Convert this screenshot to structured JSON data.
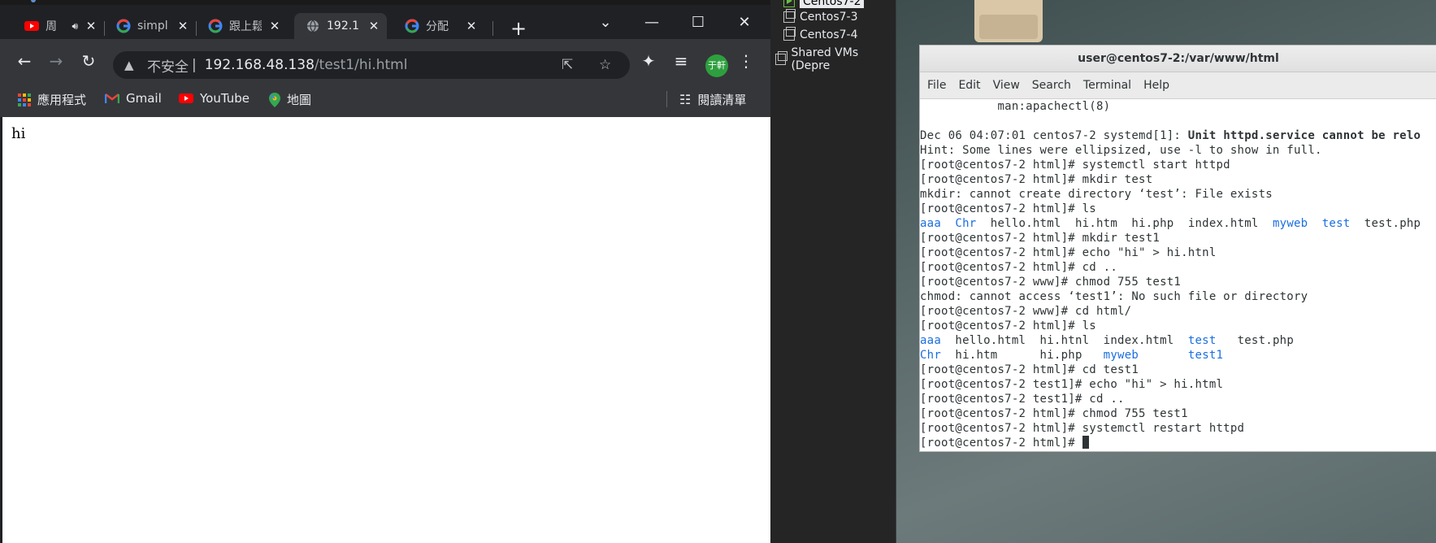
{
  "browser": {
    "tabs": [
      {
        "title": "周",
        "favicon": "youtube-icon",
        "audio": true
      },
      {
        "title": "simpl",
        "favicon": "google-icon"
      },
      {
        "title": "跟上鬆",
        "favicon": "google-icon"
      },
      {
        "title": "192.1",
        "favicon": "globe-icon",
        "active": true
      },
      {
        "title": "分配",
        "favicon": "google-icon"
      }
    ],
    "new_tab": "+",
    "window_controls": {
      "tab_search": "⌄",
      "minimize": "—",
      "maximize": "☐",
      "close": "✕"
    },
    "address": {
      "security_label": "不安全",
      "separator": "|",
      "host": "192.168.48.138",
      "path": "/test1/hi.html"
    },
    "profile_initials": "于軒",
    "bookmarks": [
      {
        "label": "應用程式",
        "icon": "apps-grid-icon"
      },
      {
        "label": "Gmail",
        "icon": "gmail-icon"
      },
      {
        "label": "YouTube",
        "icon": "youtube-icon"
      },
      {
        "label": "地圖",
        "icon": "maps-pin-icon"
      }
    ],
    "reading_list": "閱讀清單",
    "page_content": "hi"
  },
  "vm_library": {
    "items": [
      {
        "name": "Centos7-2",
        "selected": true,
        "running": true
      },
      {
        "name": "Centos7-3"
      },
      {
        "name": "Centos7-4"
      },
      {
        "name": "Shared VMs (Depre"
      }
    ]
  },
  "terminal": {
    "title": "user@centos7-2:/var/www/html",
    "menu": [
      "File",
      "Edit",
      "View",
      "Search",
      "Terminal",
      "Help"
    ],
    "lines": [
      [
        {
          "t": "           man:apachectl(8)"
        }
      ],
      [
        {
          "t": ""
        }
      ],
      [
        {
          "t": "Dec 06 04:07:01 centos7-2 systemd[1]: "
        },
        {
          "t": "Unit httpd.service cannot be relo",
          "c": "bold"
        }
      ],
      [
        {
          "t": "Hint: Some lines were ellipsized, use -l to show in full."
        }
      ],
      [
        {
          "t": "[root@centos7-2 html]# systemctl start httpd"
        }
      ],
      [
        {
          "t": "[root@centos7-2 html]# mkdir test"
        }
      ],
      [
        {
          "t": "mkdir: cannot create directory ‘test’: File exists"
        }
      ],
      [
        {
          "t": "[root@centos7-2 html]# ls"
        }
      ],
      [
        {
          "t": "aaa",
          "c": "blue"
        },
        {
          "t": "  "
        },
        {
          "t": "Chr",
          "c": "blue"
        },
        {
          "t": "  hello.html  hi.htm  hi.php  index.html  "
        },
        {
          "t": "myweb",
          "c": "blue"
        },
        {
          "t": "  "
        },
        {
          "t": "test",
          "c": "blue"
        },
        {
          "t": "  test.php"
        }
      ],
      [
        {
          "t": "[root@centos7-2 html]# mkdir test1"
        }
      ],
      [
        {
          "t": "[root@centos7-2 html]# echo \"hi\" > hi.htnl"
        }
      ],
      [
        {
          "t": "[root@centos7-2 html]# cd .."
        }
      ],
      [
        {
          "t": "[root@centos7-2 www]# chmod 755 test1"
        }
      ],
      [
        {
          "t": "chmod: cannot access ‘test1’: No such file or directory"
        }
      ],
      [
        {
          "t": "[root@centos7-2 www]# cd html/"
        }
      ],
      [
        {
          "t": "[root@centos7-2 html]# ls"
        }
      ],
      [
        {
          "t": "aaa",
          "c": "blue"
        },
        {
          "t": "  hello.html  hi.htnl  index.html  "
        },
        {
          "t": "test",
          "c": "blue"
        },
        {
          "t": "   test.php"
        }
      ],
      [
        {
          "t": "Chr",
          "c": "blue"
        },
        {
          "t": "  hi.htm      hi.php   "
        },
        {
          "t": "myweb",
          "c": "blue"
        },
        {
          "t": "       "
        },
        {
          "t": "test1",
          "c": "blue"
        }
      ],
      [
        {
          "t": "[root@centos7-2 html]# cd test1"
        }
      ],
      [
        {
          "t": "[root@centos7-2 test1]# echo \"hi\" > hi.html"
        }
      ],
      [
        {
          "t": "[root@centos7-2 test1]# cd .."
        }
      ],
      [
        {
          "t": "[root@centos7-2 html]# chmod 755 test1"
        }
      ],
      [
        {
          "t": "[root@centos7-2 html]# systemctl restart httpd"
        }
      ],
      [
        {
          "t": "[root@centos7-2 html]# "
        },
        {
          "cursor": true
        }
      ]
    ]
  }
}
